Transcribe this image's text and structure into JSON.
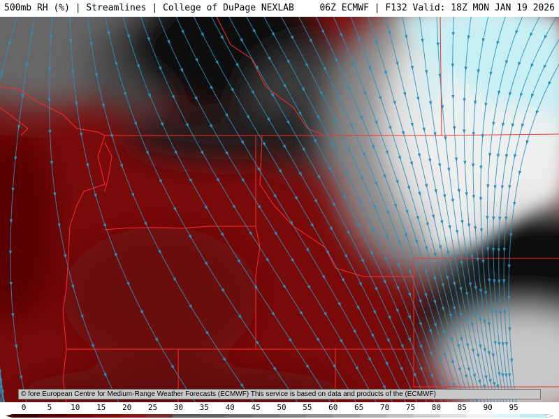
{
  "header": {
    "left": "500mb RH (%) | Streamlines | College of DuPage NEXLAB",
    "right": "06Z ECMWF | F132 Valid: 18Z MON JAN 19 2026"
  },
  "credit": "© fore European Centre for Medium-Range Weather Forecasts (ECMWF)  This service is based on data and products of the (ECMWF)",
  "legend": {
    "ticks": [
      "0",
      "5",
      "10",
      "15",
      "20",
      "25",
      "30",
      "35",
      "40",
      "45",
      "50",
      "55",
      "60",
      "65",
      "70",
      "75",
      "80",
      "85",
      "90",
      "95"
    ],
    "colors": [
      "#3c0000",
      "#5a0000",
      "#700000",
      "#820808",
      "#8f1616",
      "#7a2a2a",
      "#5c5c5c",
      "#606060",
      "#6c6c6c",
      "#787878",
      "#858585",
      "#929292",
      "#a0a0a0",
      "#b0b0b0",
      "#c0c0c0",
      "#d0d0d0",
      "#e2e2e2",
      "#f2f2f2",
      "#d9f6f9",
      "#bfeef5"
    ]
  },
  "map": {
    "boundary_color": "#ff2a2a",
    "streamline_color": "#2f8fb8"
  }
}
